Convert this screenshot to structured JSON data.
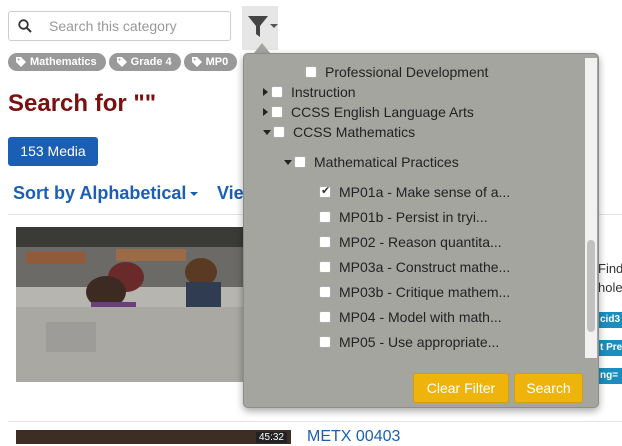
{
  "search": {
    "placeholder": "Search this category"
  },
  "tags": [
    "Mathematics",
    "Grade 4",
    "MP0"
  ],
  "title": "Search for \"\"",
  "media_count_label": "153 Media",
  "sort_label": "Sort by Alphabetical",
  "view_label": "Vie",
  "results": [
    {
      "title": "METX 00403",
      "duration": "45:32"
    }
  ],
  "side_fragments": {
    "find": "Find",
    "whole": "hole",
    "badge1": "cid3",
    "badge2": "t Pre",
    "badge3": "ng="
  },
  "filter_panel": {
    "items": [
      {
        "label": "Professional Development",
        "level": 2,
        "expander": "none",
        "checked": false
      },
      {
        "label": "Instruction",
        "level": 0,
        "expander": "collapsed",
        "checked": false
      },
      {
        "label": "CCSS English Language Arts",
        "level": 0,
        "expander": "collapsed",
        "checked": false
      },
      {
        "label": "CCSS Mathematics",
        "level": 0,
        "expander": "expanded",
        "checked": false
      },
      {
        "label": "Mathematical Practices",
        "level": 1,
        "expander": "expanded",
        "checked": false
      },
      {
        "label": "MP01a - Make sense of a...",
        "level": 2,
        "expander": "none",
        "checked": true
      },
      {
        "label": "MP01b - Persist in tryi...",
        "level": 2,
        "expander": "none",
        "checked": false
      },
      {
        "label": "MP02 - Reason quantita...",
        "level": 2,
        "expander": "none",
        "checked": false
      },
      {
        "label": "MP03a - Construct mathe...",
        "level": 2,
        "expander": "none",
        "checked": false
      },
      {
        "label": "MP03b - Critique mathem...",
        "level": 2,
        "expander": "none",
        "checked": false
      },
      {
        "label": "MP04 - Model with math...",
        "level": 2,
        "expander": "none",
        "checked": false
      },
      {
        "label": "MP05 - Use appropriate...",
        "level": 2,
        "expander": "none",
        "checked": false
      }
    ],
    "clear_label": "Clear Filter",
    "search_label": "Search"
  },
  "colors": {
    "accent_blue": "#1a5fb4",
    "title_red": "#7a1010",
    "button_yellow": "#efb40c",
    "panel_bg": "#a5a5a0"
  }
}
